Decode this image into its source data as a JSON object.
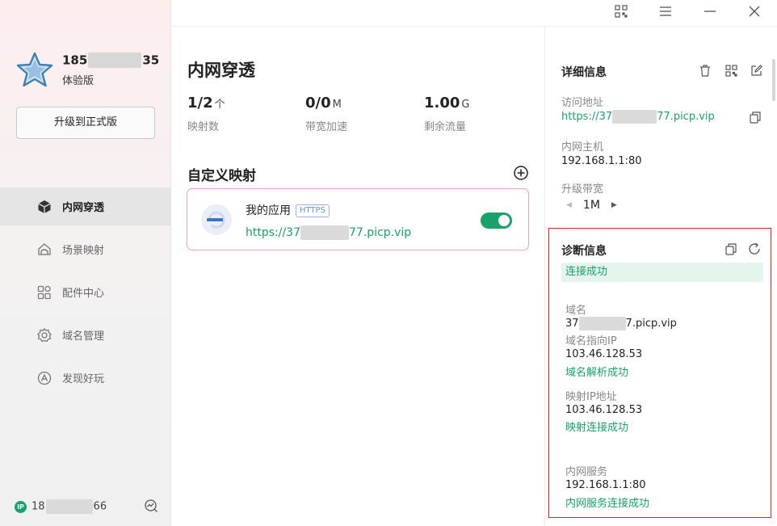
{
  "colors": {
    "accent": "#15a36b",
    "card_border": "#f2a4b6",
    "highlight_box": "#e02020",
    "success_bg": "#e6f5ec"
  },
  "sidebar": {
    "account": {
      "prefix": "185",
      "suffix": "35",
      "icon": "star-icon"
    },
    "edition": "体验版",
    "upgrade_label": "升级到正式版",
    "items": [
      {
        "label": "内网穿透",
        "icon": "cube-icon",
        "active": true
      },
      {
        "label": "场景映射",
        "icon": "scene-icon",
        "active": false
      },
      {
        "label": "配件中心",
        "icon": "accessories-icon",
        "active": false
      },
      {
        "label": "域名管理",
        "icon": "domain-icon",
        "active": false
      },
      {
        "label": "发现好玩",
        "icon": "discover-icon",
        "active": false
      }
    ],
    "footer": {
      "badge": "IP",
      "prefix": "18",
      "suffix": "66",
      "icon": "stats-icon"
    }
  },
  "titlebar": {
    "icons": [
      "qr-code-icon",
      "menu-icon",
      "minimize-icon",
      "close-icon"
    ]
  },
  "main": {
    "title": "内网穿透",
    "stats": [
      {
        "value": "1/2",
        "unit": "个",
        "label": "映射数"
      },
      {
        "value": "0/0",
        "unit": "M",
        "label": "带宽加速"
      },
      {
        "value": "1.00",
        "unit": "G",
        "label": "剩余流量"
      }
    ],
    "section_title": "自定义映射",
    "mapping": {
      "name": "我的应用",
      "protocol": "HTTPS",
      "url_prefix": "https://37",
      "url_suffix": "77.picp.vip",
      "enabled": true
    }
  },
  "details": {
    "title": "详细信息",
    "access_label": "访问地址",
    "access_prefix": "https://37",
    "access_suffix": "77.picp.vip",
    "host_label": "内网主机",
    "host_value": "192.168.1.1:80",
    "bandwidth_label": "升级带宽",
    "bandwidth_value": "1M"
  },
  "diagnostics": {
    "title": "诊断信息",
    "status": "连接成功",
    "domain_label": "域名",
    "domain_prefix": "37",
    "domain_suffix": "7.picp.vip",
    "dns_label": "域名指向IP",
    "dns_ip": "103.46.128.53",
    "dns_status": "域名解析成功",
    "map_label": "映射IP地址",
    "map_ip": "103.46.128.53",
    "map_status": "映射连接成功",
    "service_label": "内网服务",
    "service_value": "192.168.1.1:80",
    "service_status": "内网服务连接成功"
  }
}
